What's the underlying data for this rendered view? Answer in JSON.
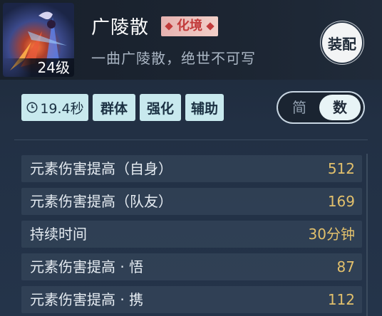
{
  "skill": {
    "name": "广陵散",
    "grade": "化境",
    "description": "一曲广陵散，绝世不可写",
    "level": "24级",
    "equip_label": "装配"
  },
  "tags": {
    "time": "19.4秒",
    "items": [
      "群体",
      "强化",
      "辅助"
    ]
  },
  "toggle": {
    "simple": "简",
    "numeric": "数",
    "selected": "数"
  },
  "stats": [
    {
      "label": "元素伤害提高（自身）",
      "value": "512"
    },
    {
      "label": "元素伤害提高（队友）",
      "value": "169"
    },
    {
      "label": "持续时间",
      "value": "30分钟"
    },
    {
      "label": "元素伤害提高 · 悟",
      "value": "87"
    },
    {
      "label": "元素伤害提高 · 携",
      "value": "112"
    }
  ],
  "colors": {
    "accent_value": "#e2c06c",
    "tag_bg": "#c8e9ee",
    "grade_text": "#c23b3b"
  }
}
